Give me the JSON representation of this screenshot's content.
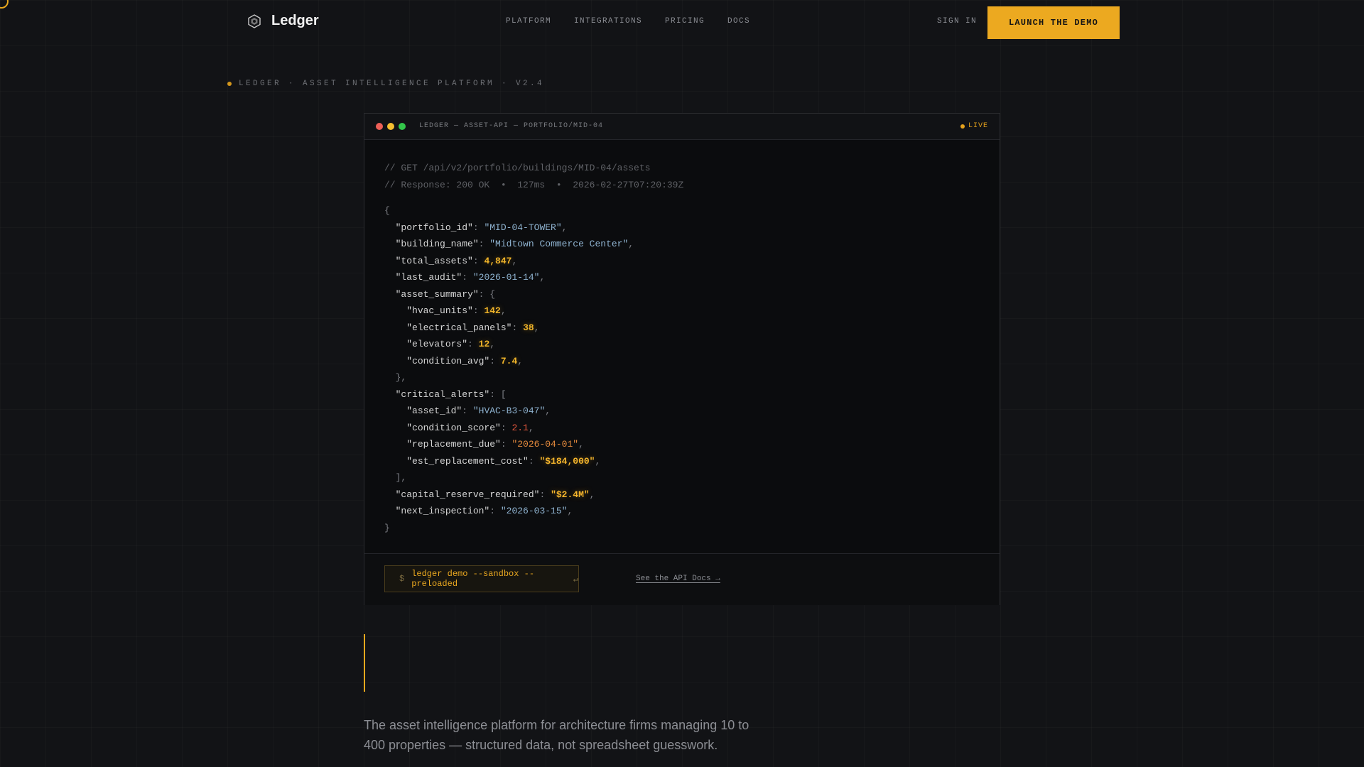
{
  "brand": {
    "name": "Ledger"
  },
  "nav": {
    "links": [
      "PLATFORM",
      "INTEGRATIONS",
      "PRICING",
      "DOCS"
    ],
    "sign_in": "SIGN IN",
    "cta": "LAUNCH THE DEMO"
  },
  "eyebrow": "LEDGER · ASSET INTELLIGENCE PLATFORM · V2.4",
  "window": {
    "title": "LEDGER — ASSET-API — PORTFOLIO/MID-04",
    "live_label": "LIVE",
    "comment_request": "// GET /api/v2/portfolio/buildings/MID-04/assets",
    "comment_response": "// Response: 200 OK  •  127ms  •  2026-02-27T07:20:39Z",
    "json": {
      "portfolio_id": "\"MID-04-TOWER\"",
      "building_name": "\"Midtown Commerce Center\"",
      "total_assets": "4,847",
      "last_audit": "\"2026-01-14\"",
      "hvac_units": "142",
      "electrical_panels": "38",
      "elevators": "12",
      "condition_avg": "7.4",
      "asset_id": "\"HVAC-B3-047\"",
      "condition_score": "2.1",
      "replacement_due": "\"2026-04-01\"",
      "est_replacement_cost": "\"$184,000\"",
      "capital_reserve_required": "\"$2.4M\"",
      "next_inspection": "\"2026-03-15\""
    },
    "command_prompt": "$",
    "command": "ledger demo --sandbox --preloaded",
    "command_enter": "↵",
    "api_docs_link": "See the API Docs →"
  },
  "tagline": "The asset intelligence platform for architecture firms managing 10 to 400 properties — structured data, not spreadsheet guesswork.",
  "colors": {
    "accent": "#eca920",
    "background": "#121316",
    "string": "#8fb3d0",
    "alert": "#e4573d"
  },
  "icons": {
    "brand": "hexagon-logo-icon"
  }
}
